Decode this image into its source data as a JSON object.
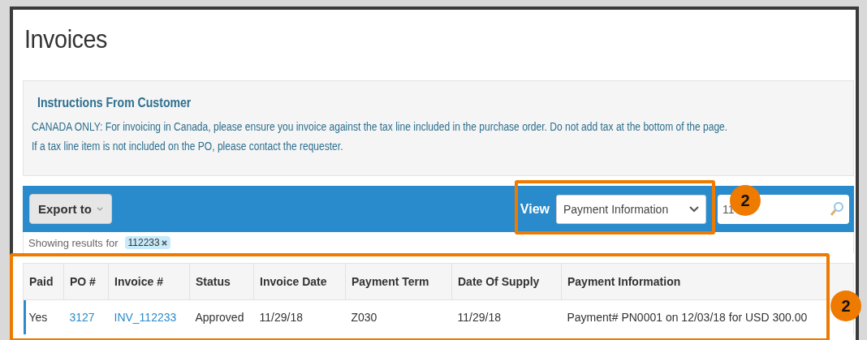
{
  "page": {
    "title": "Invoices"
  },
  "instructions": {
    "heading": "Instructions From Customer",
    "lines": [
      "CANADA ONLY: For invoicing in Canada, please ensure you invoice against the tax line included in the purchase order. Do not add tax at the bottom of the page.",
      "If a tax line item is not included on the PO, please contact the requester."
    ]
  },
  "toolbar": {
    "export_button": "Export to",
    "view_label": "View",
    "view_select": "Payment Information",
    "search": {
      "value": "11"
    }
  },
  "filter": {
    "label": "Showing results for",
    "tags": [
      "112233"
    ]
  },
  "table": {
    "columns": [
      "Paid",
      "PO #",
      "Invoice #",
      "Status",
      "Invoice Date",
      "Payment Term",
      "Date Of Supply",
      "Payment Information"
    ],
    "rows": [
      {
        "selected": true,
        "cells": [
          {
            "text": "Yes",
            "kind": "text"
          },
          {
            "text": "3127",
            "kind": "link"
          },
          {
            "text": "INV_112233",
            "kind": "link"
          },
          {
            "text": "Approved",
            "kind": "text"
          },
          {
            "text": "11/29/18",
            "kind": "text"
          },
          {
            "text": "Z030",
            "kind": "text"
          },
          {
            "text": "11/29/18",
            "kind": "text"
          },
          {
            "text": "Payment# PN0001 on 12/03/18 for USD 300.00",
            "kind": "text"
          }
        ]
      }
    ]
  },
  "view_highlight": {
    "badge": "2"
  },
  "table_highlight": {
    "badge": "2"
  }
}
